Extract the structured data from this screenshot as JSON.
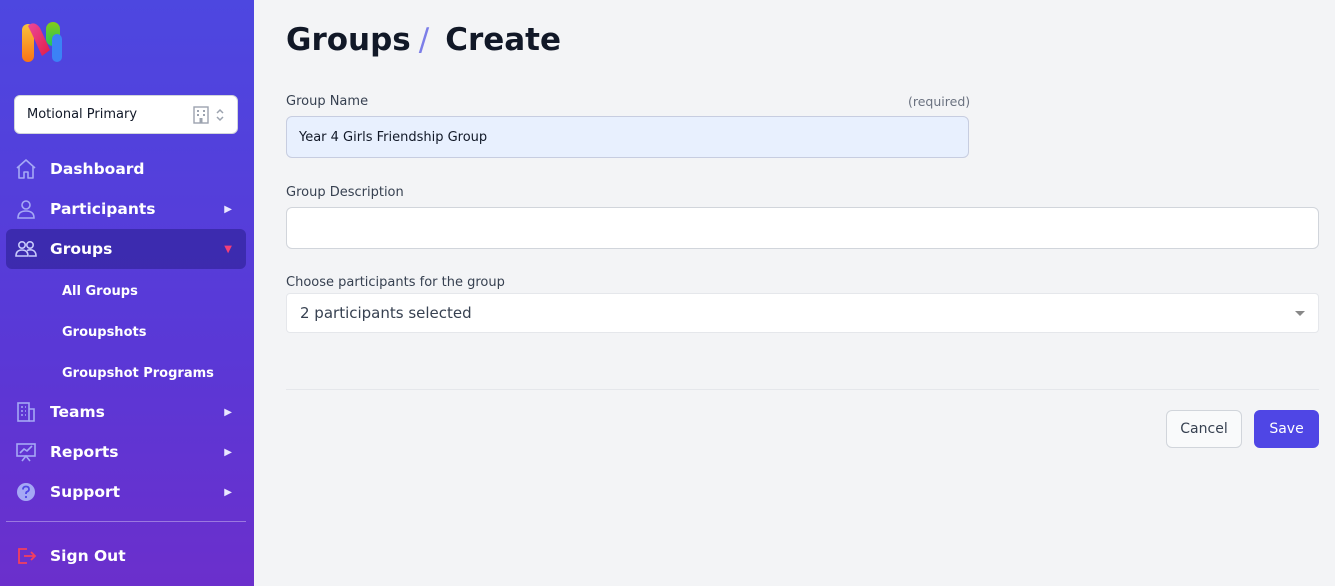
{
  "app": {
    "org_selector": {
      "value": "Motional Primary"
    }
  },
  "sidebar": {
    "items": [
      {
        "label": "Dashboard",
        "icon": "home-icon"
      },
      {
        "label": "Participants",
        "icon": "user-icon",
        "arrow": "▶"
      },
      {
        "label": "Groups",
        "icon": "users-icon",
        "arrow": "▼",
        "active": true
      },
      {
        "label": "Teams",
        "icon": "building-icon",
        "arrow": "▶"
      },
      {
        "label": "Reports",
        "icon": "presentation-chart-icon",
        "arrow": "▶"
      },
      {
        "label": "Support",
        "icon": "question-circle-icon",
        "arrow": "▶"
      },
      {
        "label": "Sign Out",
        "icon": "logout-icon"
      }
    ],
    "group_subitems": [
      {
        "label": "All Groups"
      },
      {
        "label": "Groupshots"
      },
      {
        "label": "Groupshot Programs"
      }
    ]
  },
  "page": {
    "title_section": "Groups",
    "title_separator": "/",
    "title_action": "Create"
  },
  "form": {
    "group_name": {
      "label": "Group Name",
      "required_label": "(required)",
      "value": "Year 4 Girls Friendship Group"
    },
    "group_description": {
      "label": "Group Description",
      "value": ""
    },
    "participants": {
      "label": "Choose participants for the group",
      "value": "2 participants selected"
    },
    "cancel_label": "Cancel",
    "save_label": "Save"
  },
  "colors": {
    "sidebar_top": "#4d47e0",
    "sidebar_bottom": "#6b2fcc",
    "primary": "#4f46e5",
    "active_arrow": "#f43f77",
    "signout_icon": "#f43f5e",
    "title_separator": "#7c7ee8"
  }
}
